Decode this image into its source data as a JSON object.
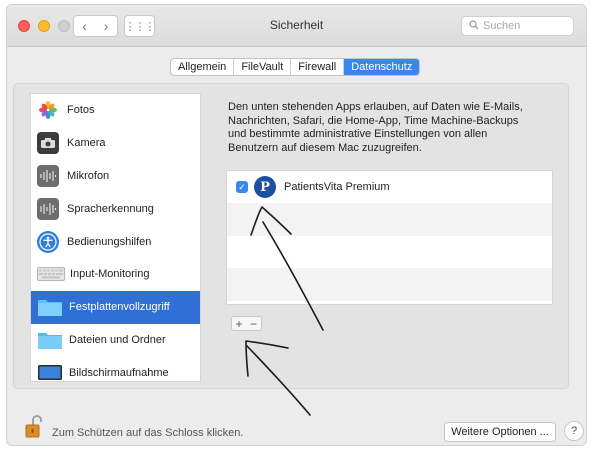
{
  "window": {
    "title": "Sicherheit",
    "search_placeholder": "Suchen",
    "nav": {
      "back": "‹",
      "forward": "›",
      "grid": "⋮⋮⋮"
    }
  },
  "tabs": [
    {
      "label": "Allgemein",
      "active": false
    },
    {
      "label": "FileVault",
      "active": false
    },
    {
      "label": "Firewall",
      "active": false
    },
    {
      "label": "Datenschutz",
      "active": true
    }
  ],
  "sidebar": {
    "items": [
      {
        "label": "Fotos",
        "icon": "photos-icon"
      },
      {
        "label": "Kamera",
        "icon": "camera-icon"
      },
      {
        "label": "Mikrofon",
        "icon": "microphone-icon"
      },
      {
        "label": "Spracherkennung",
        "icon": "speech-recognition-icon"
      },
      {
        "label": "Bedienungshilfen",
        "icon": "accessibility-icon"
      },
      {
        "label": "Input-Monitoring",
        "icon": "keyboard-icon"
      },
      {
        "label": "Festplattenvollzugriff",
        "icon": "folder-icon",
        "selected": true
      },
      {
        "label": "Dateien und Ordner",
        "icon": "folder-icon"
      },
      {
        "label": "Bildschirmaufnahme",
        "icon": "display-icon"
      }
    ]
  },
  "main": {
    "description": "Den unten stehenden Apps erlauben, auf Daten wie E-Mails, Nachrichten, Safari, die Home-App, Time Machine-Backups und bestimmte administrative Einstellungen von allen Benutzern auf diesem Mac zuzugreifen.",
    "apps": [
      {
        "name": "PatientsVita Premium",
        "checked": true,
        "icon_letter": "P"
      }
    ],
    "add_label": "+",
    "remove_label": "−"
  },
  "footer": {
    "lock_label": "Zum Schützen auf das Schloss klicken.",
    "more_options": "Weitere Optionen ...",
    "help": "?"
  },
  "colors": {
    "accent": "#3a86f0",
    "selection": "#2f6fd6",
    "app_icon": "#1d4fa3"
  }
}
